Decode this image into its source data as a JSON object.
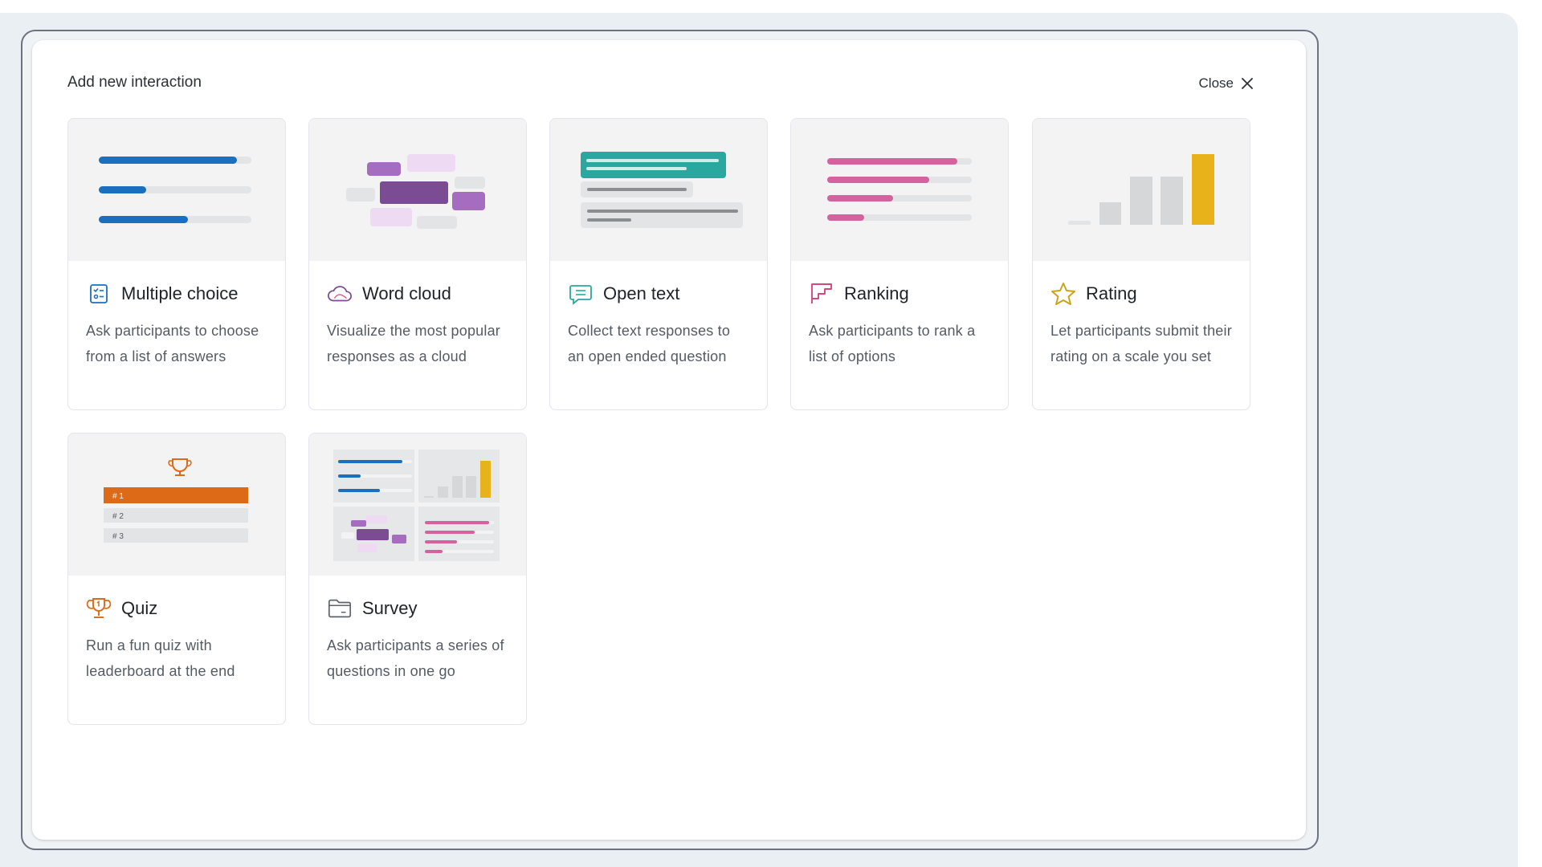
{
  "modal": {
    "title": "Add new interaction",
    "close_label": "Close"
  },
  "colors": {
    "blue": "#1a6fbf",
    "purple": "#7b4b94",
    "teal": "#2aa89f",
    "pink": "#d4629f",
    "yellow": "#e8b21b",
    "orange": "#dd6a16"
  },
  "interactions": [
    {
      "title": "Multiple choice",
      "desc": "Ask participants to choose from a list of answers",
      "icon": "checklist-icon"
    },
    {
      "title": "Word cloud",
      "desc": "Visualize the most popular responses as a cloud",
      "icon": "cloud-icon"
    },
    {
      "title": "Open text",
      "desc": "Collect text responses to an open ended question",
      "icon": "chat-bubble-icon"
    },
    {
      "title": "Ranking",
      "desc": "Ask participants to rank a list of options",
      "icon": "ranking-icon"
    },
    {
      "title": "Rating",
      "desc": "Let participants submit their rating on a scale you set",
      "icon": "star-icon"
    },
    {
      "title": "Quiz",
      "desc": "Run a fun quiz with leaderboard at the end",
      "icon": "trophy-icon",
      "preview_ranks": [
        "# 1",
        "# 2",
        "# 3"
      ]
    },
    {
      "title": "Survey",
      "desc": "Ask participants a series of questions in one go",
      "icon": "folder-icon"
    }
  ]
}
